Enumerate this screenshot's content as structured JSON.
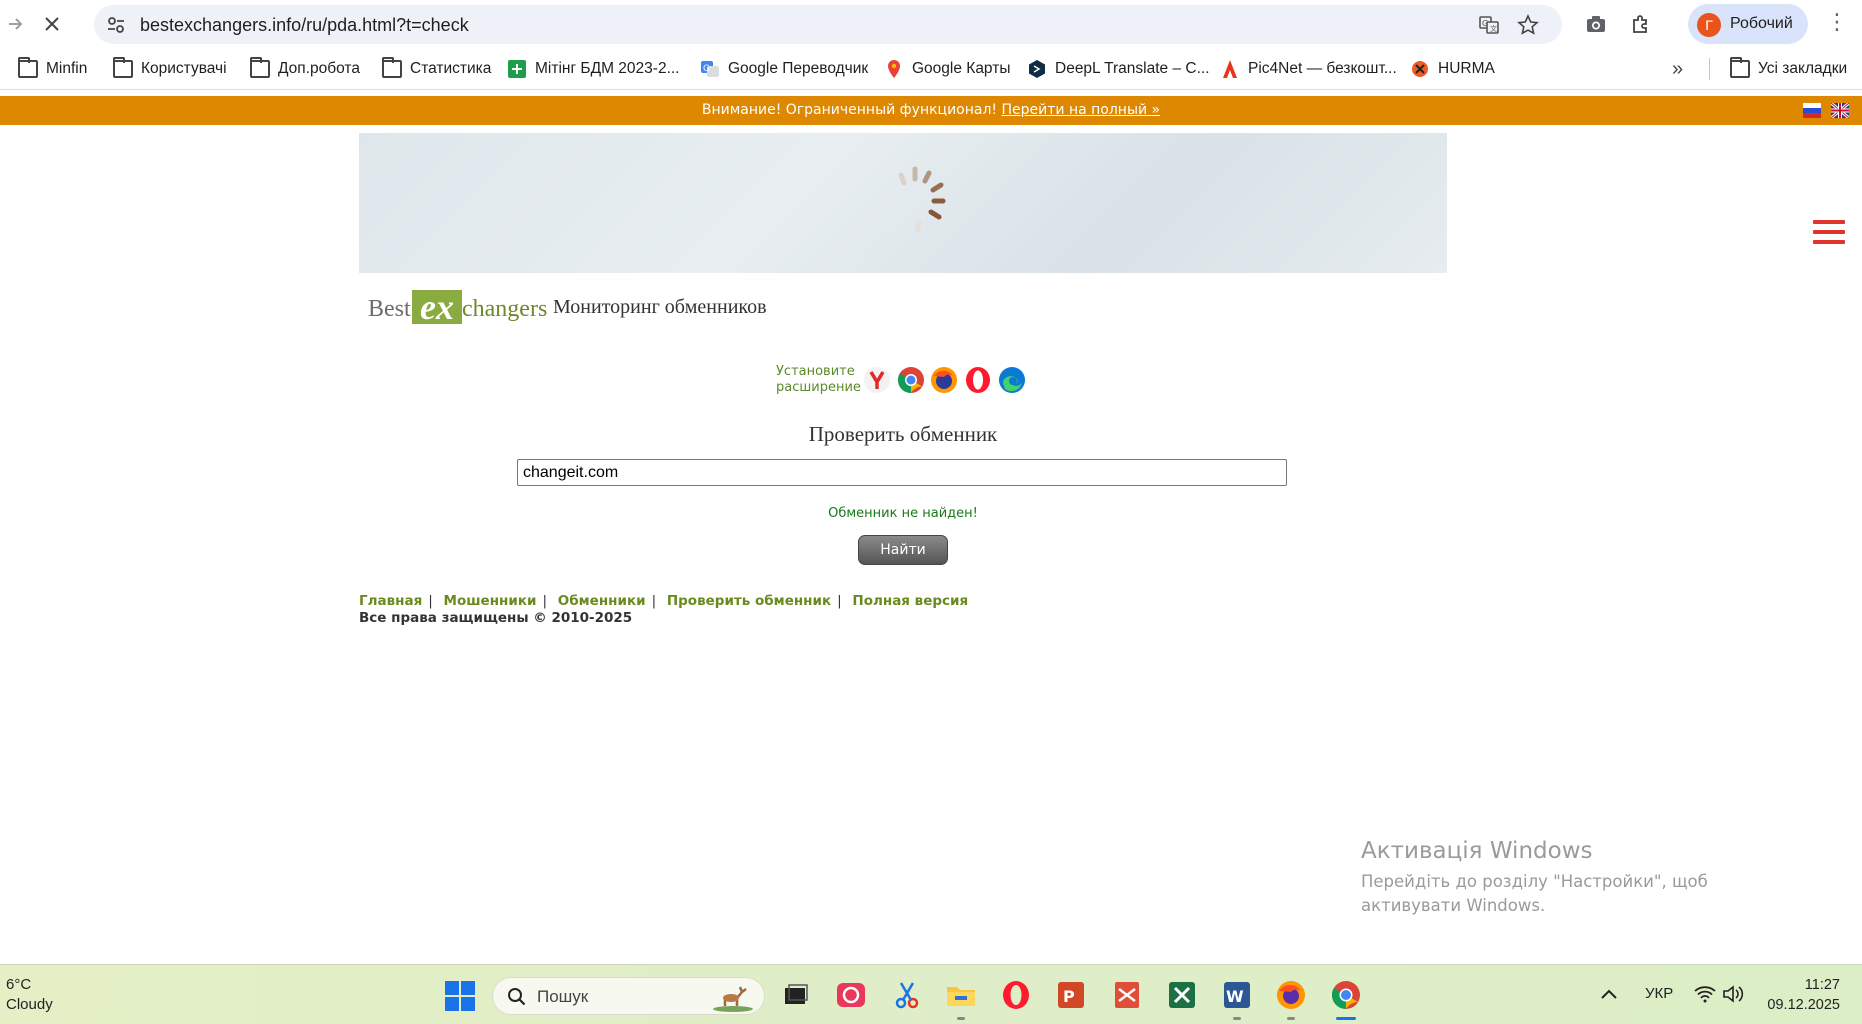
{
  "browser": {
    "url": "bestexchangers.info/ru/pda.html?t=check",
    "profile_initial": "Г",
    "profile_name": "Робочий",
    "bookmarks": [
      {
        "label": "Minfin",
        "icon": "folder-icon"
      },
      {
        "label": "Користувачі",
        "icon": "folder-icon"
      },
      {
        "label": "Доп.робота",
        "icon": "folder-icon"
      },
      {
        "label": "Статистика",
        "icon": "folder-icon"
      },
      {
        "label": "Мітінг БДМ 2023-2...",
        "icon": "sheets-icon"
      },
      {
        "label": "Google Переводчик",
        "icon": "translate-icon"
      },
      {
        "label": "Google Карты",
        "icon": "maps-icon"
      },
      {
        "label": "DeepL Translate – С...",
        "icon": "deepl-icon"
      },
      {
        "label": "Pic4Net — безкошт...",
        "icon": "pic4net-icon"
      },
      {
        "label": "HURMA",
        "icon": "hurma-icon"
      },
      {
        "label": "Усі закладки",
        "icon": "folder-icon"
      }
    ]
  },
  "page": {
    "notice_text": "Внимание! Ограниченный функционал!",
    "notice_link": "Перейти на полный »",
    "logo": {
      "best": "Best",
      "ex": "ex",
      "changers": "changers"
    },
    "subtitle": "Мониторинг обменников",
    "extension_line1": "Установите",
    "extension_line2": "расширение",
    "check_heading": "Проверить обменник",
    "input_value": "changeit.com",
    "result_message": "Обменник не найден!",
    "find_button": "Найти",
    "footer_links": [
      "Главная",
      "Мошенники",
      "Обменники",
      "Проверить обменник",
      "Полная версия"
    ],
    "copyright": "Все права защищены © 2010-2025",
    "colors": {
      "notice_bar": "#dd8800",
      "footer_link": "#6a8a1e",
      "menu_icon": "#e0332b",
      "result_ok": "#1a7a1a"
    }
  },
  "windows": {
    "activation_title": "Активація Windows",
    "activation_text": "Перейдіть до розділу \"Настройки\", щоб активувати Windows.",
    "weather_temp": "6°C",
    "weather_desc": "Cloudy",
    "search_placeholder": "Пошук",
    "lang": "УКР",
    "time": "11:27",
    "date": "09.12.2025"
  }
}
